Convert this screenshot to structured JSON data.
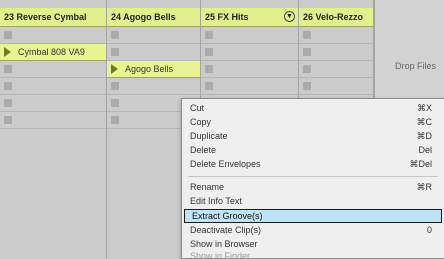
{
  "tracks": [
    {
      "name": "23 Reverse Cymbal",
      "clips": [
        {
          "row": 2,
          "name": "Cymbal 808 VA9"
        }
      ]
    },
    {
      "name": "24 Agogo Bells",
      "clips": [
        {
          "row": 3,
          "name": "Agogo Bells"
        }
      ]
    },
    {
      "name": "25 FX Hits",
      "fold_icon": "▼",
      "clips": []
    },
    {
      "name": "26 Velo-Rezzo",
      "clips": []
    }
  ],
  "drop_area": {
    "label": "Drop Files"
  },
  "context_menu": {
    "items": [
      {
        "label": "Cut",
        "shortcut": "⌘X",
        "disabled": false
      },
      {
        "label": "Copy",
        "shortcut": "⌘C",
        "disabled": false
      },
      {
        "label": "Duplicate",
        "shortcut": "⌘D",
        "disabled": false
      },
      {
        "label": "Delete",
        "shortcut": "Del",
        "disabled": false
      },
      {
        "label": "Delete Envelopes",
        "shortcut": "⌘Del",
        "disabled": false
      },
      {
        "label": "Rename",
        "shortcut": "⌘R",
        "disabled": false
      },
      {
        "label": "Edit Info Text",
        "shortcut": "",
        "disabled": false
      },
      {
        "label": "Extract Groove(s)",
        "shortcut": "",
        "disabled": false,
        "highlighted": true
      },
      {
        "label": "Deactivate Clip(s)",
        "shortcut": "0",
        "disabled": false
      },
      {
        "label": "Show in Browser",
        "shortcut": "",
        "disabled": false
      },
      {
        "label": "Show in Finder",
        "shortcut": "",
        "disabled": true
      }
    ]
  },
  "colors": {
    "clip": "#e8f391",
    "header": "#e1f08c",
    "highlight": "#bfe3f7"
  }
}
